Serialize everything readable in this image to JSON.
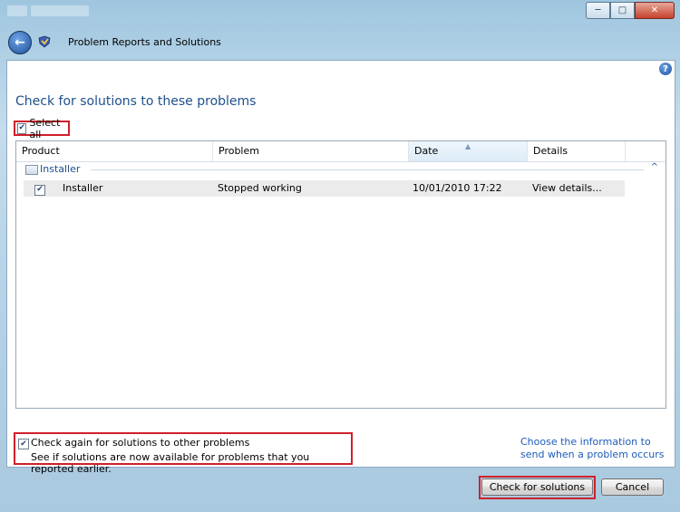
{
  "window": {
    "nav_title": "Problem Reports and Solutions"
  },
  "page": {
    "title": "Check for solutions to these problems",
    "select_all_label": "Select all"
  },
  "table": {
    "columns": [
      "Product",
      "Problem",
      "Date",
      "Details"
    ],
    "group_label": "Installer",
    "rows": [
      {
        "product": "Installer",
        "problem": "Stopped working",
        "date": "10/01/2010 17:22",
        "details": "View details..."
      }
    ]
  },
  "options": {
    "check_again_label": "Check again for solutions to other problems",
    "check_again_sub": "See if solutions are now available for problems that you reported earlier."
  },
  "link_text": "Choose the information to send when a problem occurs",
  "buttons": {
    "check": "Check for solutions",
    "cancel": "Cancel"
  },
  "icons": {
    "back": "back-arrow-icon",
    "app": "problem-reports-icon",
    "help": "help-icon"
  },
  "colors": {
    "highlight": "#d0202a",
    "title_text": "#1e4f8c",
    "link": "#1e5bb8"
  }
}
